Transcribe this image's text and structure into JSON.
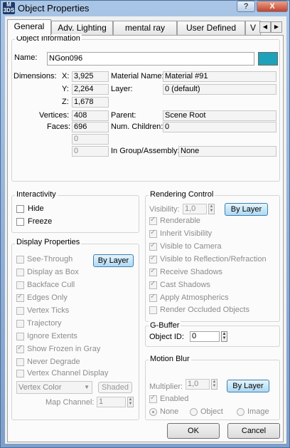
{
  "window": {
    "title": "Object Properties",
    "icon_label": "M 3DS",
    "help_label": "?",
    "close_label": "X"
  },
  "tabs": [
    "General",
    "Adv. Lighting",
    "mental ray",
    "User Defined",
    "V"
  ],
  "object_info": {
    "heading": "Object Information",
    "name_label": "Name:",
    "name_value": "NGon096",
    "color": "#1ea2b9",
    "dimensions_label": "Dimensions:",
    "x_label": "X:",
    "x_value": "3,925",
    "y_label": "Y:",
    "y_value": "2,264",
    "z_label": "Z:",
    "z_value": "1,678",
    "vertices_label": "Vertices:",
    "vertices_value": "408",
    "faces_label": "Faces:",
    "faces_value": "696",
    "extra1_value": "0",
    "extra2_value": "0",
    "material_name_label": "Material Name:",
    "material_name_value": "Material #91",
    "layer_label": "Layer:",
    "layer_value": "0 (default)",
    "parent_label": "Parent:",
    "parent_value": "Scene Root",
    "num_children_label": "Num. Children:",
    "num_children_value": "0",
    "group_label": "In Group/Assembly:",
    "group_value": "None"
  },
  "interactivity": {
    "heading": "Interactivity",
    "hide": "Hide",
    "freeze": "Freeze"
  },
  "display": {
    "heading": "Display Properties",
    "by_layer": "By Layer",
    "see_through": "See-Through",
    "display_as_box": "Display as Box",
    "backface_cull": "Backface Cull",
    "edges_only": "Edges Only",
    "vertex_ticks": "Vertex Ticks",
    "trajectory": "Trajectory",
    "ignore_extents": "Ignore Extents",
    "show_frozen_gray": "Show Frozen in Gray",
    "never_degrade": "Never Degrade",
    "vertex_channel_display": "Vertex Channel Display",
    "vertex_color": "Vertex Color",
    "shaded": "Shaded",
    "map_channel_label": "Map Channel:",
    "map_channel_value": "1"
  },
  "rendering": {
    "heading": "Rendering Control",
    "visibility_label": "Visibility:",
    "visibility_value": "1,0",
    "by_layer": "By Layer",
    "renderable": "Renderable",
    "inherit_visibility": "Inherit Visibility",
    "visible_to_camera": "Visible to Camera",
    "visible_reflection": "Visible to Reflection/Refraction",
    "receive_shadows": "Receive Shadows",
    "cast_shadows": "Cast Shadows",
    "apply_atmospherics": "Apply Atmospherics",
    "render_occluded": "Render Occluded Objects"
  },
  "gbuffer": {
    "heading": "G-Buffer",
    "object_id_label": "Object ID:",
    "object_id_value": "0"
  },
  "motion_blur": {
    "heading": "Motion Blur",
    "multiplier_label": "Multiplier:",
    "multiplier_value": "1,0",
    "by_layer": "By Layer",
    "enabled": "Enabled",
    "none": "None",
    "object": "Object",
    "image": "Image"
  },
  "footer": {
    "ok": "OK",
    "cancel": "Cancel"
  },
  "icons": {
    "spinner": "spinner-arrows",
    "dropdown": "chevron-down",
    "tab_scroll": [
      "arrow-left",
      "arrow-right"
    ]
  }
}
